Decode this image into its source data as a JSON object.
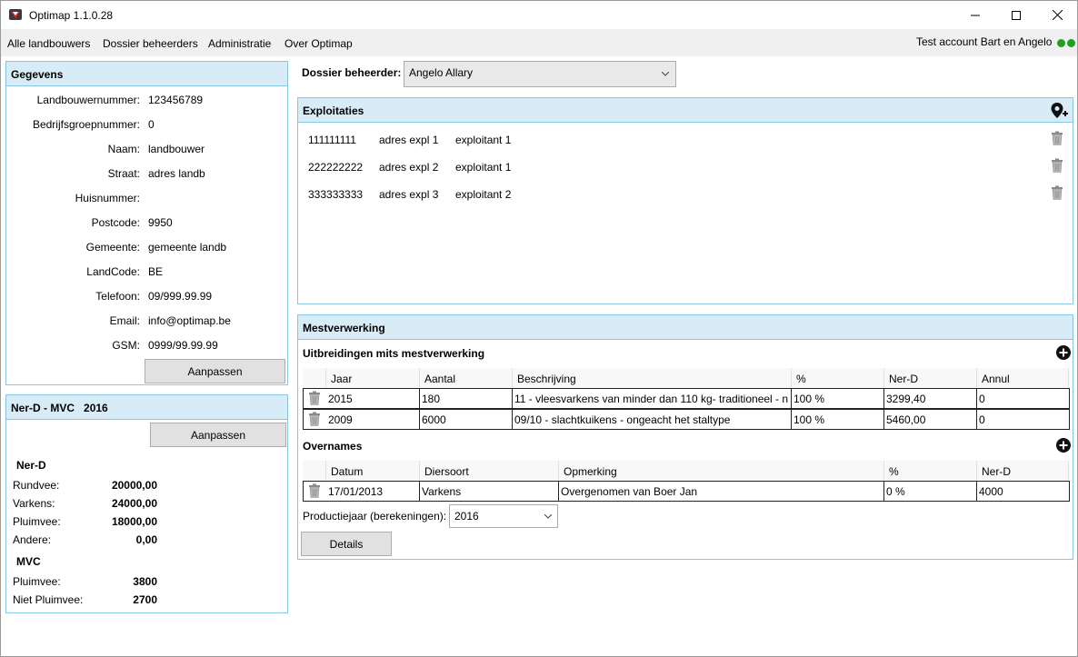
{
  "window": {
    "title": "Optimap 1.1.0.28",
    "minimize_symbol": "—",
    "maximize_symbol": "☐",
    "close_symbol": "✕"
  },
  "menu": {
    "items": [
      "Alle landbouwers",
      "Dossier beheerders",
      "Administratie",
      "Over Optimap"
    ],
    "account": "Test account Bart en Angelo"
  },
  "gegevens": {
    "title": "Gegevens",
    "fields": [
      {
        "label": "Landbouwernummer:",
        "value": "123456789"
      },
      {
        "label": "Bedrijfsgroepnummer:",
        "value": "0"
      },
      {
        "label": "Naam:",
        "value": "landbouwer"
      },
      {
        "label": "Straat:",
        "value": "adres landb"
      },
      {
        "label": "Huisnummer:",
        "value": ""
      },
      {
        "label": "Postcode:",
        "value": "9950"
      },
      {
        "label": "Gemeente:",
        "value": "gemeente landb"
      },
      {
        "label": "LandCode:",
        "value": "BE"
      },
      {
        "label": "Telefoon:",
        "value": "09/999.99.99"
      },
      {
        "label": "Email:",
        "value": "info@optimap.be"
      },
      {
        "label": "GSM:",
        "value": "0999/99.99.99"
      }
    ],
    "button": "Aanpassen"
  },
  "nerd_mvc": {
    "title": "Ner-D - MVC",
    "year": "2016",
    "button": "Aanpassen",
    "nerd_heading": "Ner-D",
    "nerd_rows": [
      {
        "label": "Rundvee:",
        "value": "20000,00"
      },
      {
        "label": "Varkens:",
        "value": "24000,00"
      },
      {
        "label": "Pluimvee:",
        "value": "18000,00"
      },
      {
        "label": "Andere:",
        "value": "0,00"
      }
    ],
    "mvc_heading": "MVC",
    "mvc_rows": [
      {
        "label": "Pluimvee:",
        "value": "3800"
      },
      {
        "label": "Niet Pluimvee:",
        "value": "2700"
      }
    ]
  },
  "dossier": {
    "label": "Dossier beheerder:",
    "value": "Angelo Allary"
  },
  "exploitaties": {
    "title": "Exploitaties",
    "rows": [
      {
        "nummer": "111111111",
        "adres": "adres expl 1",
        "exploitant": "exploitant 1"
      },
      {
        "nummer": "222222222",
        "adres": "adres expl 2",
        "exploitant": "exploitant 1"
      },
      {
        "nummer": "333333333",
        "adres": "adres expl 3",
        "exploitant": "exploitant 2"
      }
    ]
  },
  "mestverwerking": {
    "title": "Mestverwerking",
    "uitbreidingen": {
      "title": "Uitbreidingen mits mestverwerking",
      "columns": [
        "Jaar",
        "Aantal",
        "Beschrijving",
        "%",
        "Ner-D",
        "Annul"
      ],
      "rows": [
        [
          "2015",
          "180",
          "11 - vleesvarkens van minder dan 110 kg- traditioneel - n",
          "100 %",
          "3299,40",
          "0"
        ],
        [
          "2009",
          "6000",
          "09/10 - slachtkuikens - ongeacht het staltype",
          "100 %",
          "5460,00",
          "0"
        ]
      ]
    },
    "overnames": {
      "title": "Overnames",
      "columns": [
        "Datum",
        "Diersoort",
        "Opmerking",
        "%",
        "Ner-D"
      ],
      "rows": [
        [
          "17/01/2013",
          "Varkens",
          "Overgenomen van Boer Jan",
          "0 %",
          "4000"
        ]
      ]
    },
    "productiejaar_label": "Productiejaar (berekeningen):",
    "productiejaar_value": "2016",
    "details_button": "Details"
  },
  "colors": {
    "header_bg": "#d8ecf8",
    "header_border": "#88c6e6",
    "status_green": "#1fa01f"
  }
}
